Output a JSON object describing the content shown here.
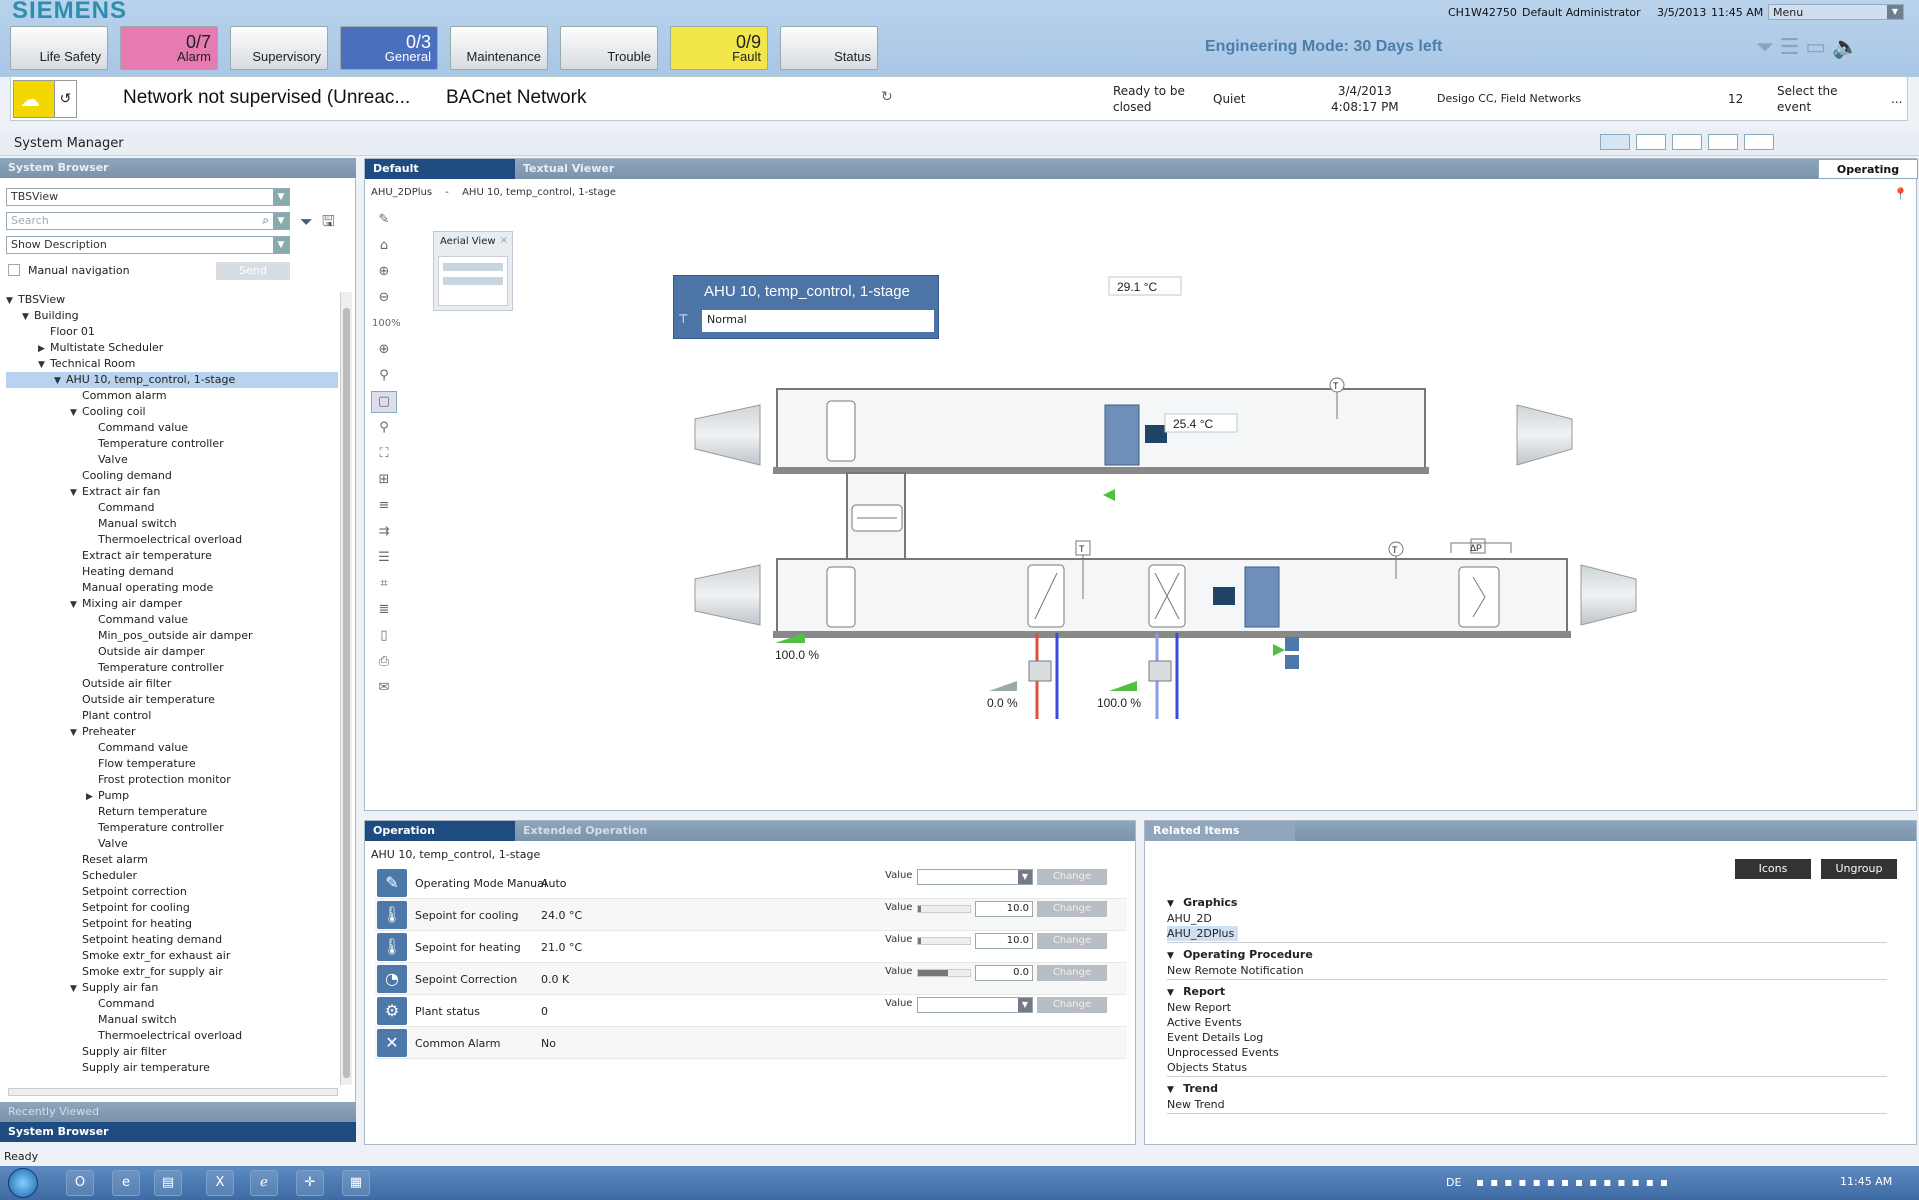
{
  "header": {
    "logo": "SIEMENS",
    "station": "CH1W42750",
    "user": "Default Administrator",
    "date": "3/5/2013",
    "time": "11:45 AM",
    "menu": "Menu",
    "engineering_mode": "Engineering Mode: 30 Days left",
    "categories": [
      {
        "label": "Life Safety",
        "count": "",
        "color": "#e8e8e8"
      },
      {
        "label": "Alarm",
        "count": "0/7",
        "color": "#e57bb0"
      },
      {
        "label": "Supervisory",
        "count": "",
        "color": "#e8e8e8"
      },
      {
        "label": "General",
        "count": "0/3",
        "color": "#4a6fbf"
      },
      {
        "label": "Maintenance",
        "count": "",
        "color": "#e8e8e8"
      },
      {
        "label": "Trouble",
        "count": "",
        "color": "#e8e8e8"
      },
      {
        "label": "Fault",
        "count": "0/9",
        "color": "#f2e64a"
      },
      {
        "label": "Status",
        "count": "",
        "color": "#e8e8e8"
      }
    ]
  },
  "event": {
    "description": "Network not supervised (Unreac...",
    "source": "BACnet Network",
    "state_line1": "Ready to be",
    "state_line2": "closed",
    "quiet": "Quiet",
    "date": "3/4/2013",
    "time": "4:08:17 PM",
    "discipline": "Desigo CC, Field Networks",
    "count": "12",
    "select_line1": "Select the",
    "select_line2": "event",
    "more": "..."
  },
  "app": {
    "title": "System Manager",
    "mode_tab": "Operating"
  },
  "system_browser": {
    "header": "System Browser",
    "view": "TBSView",
    "search_placeholder": "Search",
    "description": "Show Description",
    "manual_nav": "Manual navigation",
    "send": "Send",
    "recently_viewed": "Recently Viewed",
    "footer_tab": "System Browser",
    "tree": [
      {
        "label": "TBSView",
        "level": 0,
        "exp": "down"
      },
      {
        "label": "Building",
        "level": 1,
        "exp": "down"
      },
      {
        "label": "Floor 01",
        "level": 2,
        "exp": ""
      },
      {
        "label": "Multistate Scheduler",
        "level": 2,
        "exp": "right"
      },
      {
        "label": "Technical Room",
        "level": 2,
        "exp": "down"
      },
      {
        "label": "AHU 10, temp_control, 1-stage",
        "level": 3,
        "exp": "down",
        "selected": true
      },
      {
        "label": "Common alarm",
        "level": 4,
        "exp": ""
      },
      {
        "label": "Cooling coil",
        "level": 4,
        "exp": "down"
      },
      {
        "label": "Command value",
        "level": 5,
        "exp": ""
      },
      {
        "label": "Temperature controller",
        "level": 5,
        "exp": ""
      },
      {
        "label": "Valve",
        "level": 5,
        "exp": ""
      },
      {
        "label": "Cooling demand",
        "level": 4,
        "exp": ""
      },
      {
        "label": "Extract air fan",
        "level": 4,
        "exp": "down"
      },
      {
        "label": "Command",
        "level": 5,
        "exp": ""
      },
      {
        "label": "Manual switch",
        "level": 5,
        "exp": ""
      },
      {
        "label": "Thermoelectrical overload",
        "level": 5,
        "exp": ""
      },
      {
        "label": "Extract air temperature",
        "level": 4,
        "exp": ""
      },
      {
        "label": "Heating demand",
        "level": 4,
        "exp": ""
      },
      {
        "label": "Manual operating mode",
        "level": 4,
        "exp": ""
      },
      {
        "label": "Mixing air damper",
        "level": 4,
        "exp": "down"
      },
      {
        "label": "Command value",
        "level": 5,
        "exp": ""
      },
      {
        "label": "Min_pos_outside air damper",
        "level": 5,
        "exp": ""
      },
      {
        "label": "Outside air damper",
        "level": 5,
        "exp": ""
      },
      {
        "label": "Temperature controller",
        "level": 5,
        "exp": ""
      },
      {
        "label": "Outside air filter",
        "level": 4,
        "exp": ""
      },
      {
        "label": "Outside air temperature",
        "level": 4,
        "exp": ""
      },
      {
        "label": "Plant control",
        "level": 4,
        "exp": ""
      },
      {
        "label": "Preheater",
        "level": 4,
        "exp": "down"
      },
      {
        "label": "Command value",
        "level": 5,
        "exp": ""
      },
      {
        "label": "Flow temperature",
        "level": 5,
        "exp": ""
      },
      {
        "label": "Frost protection monitor",
        "level": 5,
        "exp": ""
      },
      {
        "label": "Pump",
        "level": 5,
        "exp": "right"
      },
      {
        "label": "Return temperature",
        "level": 5,
        "exp": ""
      },
      {
        "label": "Temperature controller",
        "level": 5,
        "exp": ""
      },
      {
        "label": "Valve",
        "level": 5,
        "exp": ""
      },
      {
        "label": "Reset alarm",
        "level": 4,
        "exp": ""
      },
      {
        "label": "Scheduler",
        "level": 4,
        "exp": ""
      },
      {
        "label": "Setpoint correction",
        "level": 4,
        "exp": ""
      },
      {
        "label": "Setpoint for cooling",
        "level": 4,
        "exp": ""
      },
      {
        "label": "Setpoint for heating",
        "level": 4,
        "exp": ""
      },
      {
        "label": "Setpoint heating demand",
        "level": 4,
        "exp": ""
      },
      {
        "label": "Smoke extr_for exhaust air",
        "level": 4,
        "exp": ""
      },
      {
        "label": "Smoke extr_for supply air",
        "level": 4,
        "exp": ""
      },
      {
        "label": "Supply air fan",
        "level": 4,
        "exp": "down"
      },
      {
        "label": "Command",
        "level": 5,
        "exp": ""
      },
      {
        "label": "Manual switch",
        "level": 5,
        "exp": ""
      },
      {
        "label": "Thermoelectrical overload",
        "level": 5,
        "exp": ""
      },
      {
        "label": "Supply air filter",
        "level": 4,
        "exp": ""
      },
      {
        "label": "Supply air temperature",
        "level": 4,
        "exp": ""
      }
    ]
  },
  "viewer": {
    "tabs": [
      "Default",
      "Textual Viewer"
    ],
    "breadcrumb1": "AHU_2DPlus",
    "breadcrumb_sep": "-",
    "breadcrumb2": "AHU 10, temp_control, 1-stage",
    "zoom": "100%",
    "aerial_view": "Aerial View",
    "graphic": {
      "title": "AHU 10, temp_control, 1-stage",
      "status": "Normal",
      "extract_temp": "29.1 °C",
      "supply_temp": "25.4 °C",
      "damper_pct": "100.0 %",
      "heat_valve_pct": "0.0 %",
      "cool_valve_pct": "100.0 %",
      "t_label": "T",
      "p_label": "ΔP"
    }
  },
  "operation": {
    "tabs": [
      "Operation",
      "Extended Operation"
    ],
    "object": "AHU 10, temp_control, 1-stage",
    "value_label": "Value",
    "change_label": "Change",
    "rows": [
      {
        "name": "Operating Mode Manual",
        "value": "Auto",
        "input": "",
        "icon": "pen-icon",
        "glyph": "✎"
      },
      {
        "name": "Sepoint for cooling",
        "value": "24.0 °C",
        "input": "10.0",
        "icon": "thermometer-icon",
        "glyph": "🌡"
      },
      {
        "name": "Sepoint for heating",
        "value": "21.0 °C",
        "input": "10.0",
        "icon": "thermometer-plus-icon",
        "glyph": "🌡"
      },
      {
        "name": "Sepoint Correction",
        "value": "0.0 K",
        "input": "0.0",
        "icon": "gauge-icon",
        "glyph": "◔"
      },
      {
        "name": "Plant status",
        "value": "0",
        "input": "",
        "icon": "gear-icon",
        "glyph": "⚙"
      },
      {
        "name": "Common Alarm",
        "value": "No",
        "input": "",
        "icon": "close-icon",
        "glyph": "✕"
      }
    ]
  },
  "related": {
    "header": "Related Items",
    "icons_btn": "Icons",
    "ungroup_btn": "Ungroup",
    "groups": [
      {
        "title": "Graphics",
        "items": [
          "AHU_2D",
          "AHU_2DPlus"
        ]
      },
      {
        "title": "Operating Procedure",
        "items": [
          "New Remote Notification"
        ]
      },
      {
        "title": "Report",
        "items": [
          "New Report",
          "Active Events",
          "Event Details Log",
          "Unprocessed Events",
          "Objects Status"
        ]
      },
      {
        "title": "Trend",
        "items": [
          "New Trend"
        ]
      }
    ]
  },
  "status": {
    "text": "Ready"
  },
  "taskbar": {
    "lang": "DE",
    "time": "11:45 AM"
  }
}
